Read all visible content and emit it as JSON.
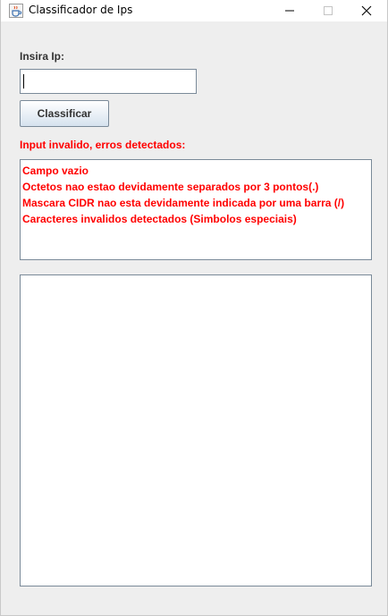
{
  "window": {
    "title": "Classificador de Ips",
    "icon": "java-cup-icon"
  },
  "form": {
    "ip_label": "Insira Ip:",
    "ip_value": "",
    "submit_label": "Classificar"
  },
  "errors": {
    "title": "Input invalido, erros detectados:",
    "lines": [
      "Campo vazio",
      "Octetos nao estao devidamente separados por 3 pontos(.)",
      "Mascara CIDR nao esta devidamente indicada por uma barra (/)",
      "Caracteres invalidos detectados (Simbolos especiais)"
    ]
  },
  "result": {
    "text": ""
  },
  "colors": {
    "error": "#ff0000",
    "background": "#eeeeee",
    "field_border": "#7a8a99"
  }
}
